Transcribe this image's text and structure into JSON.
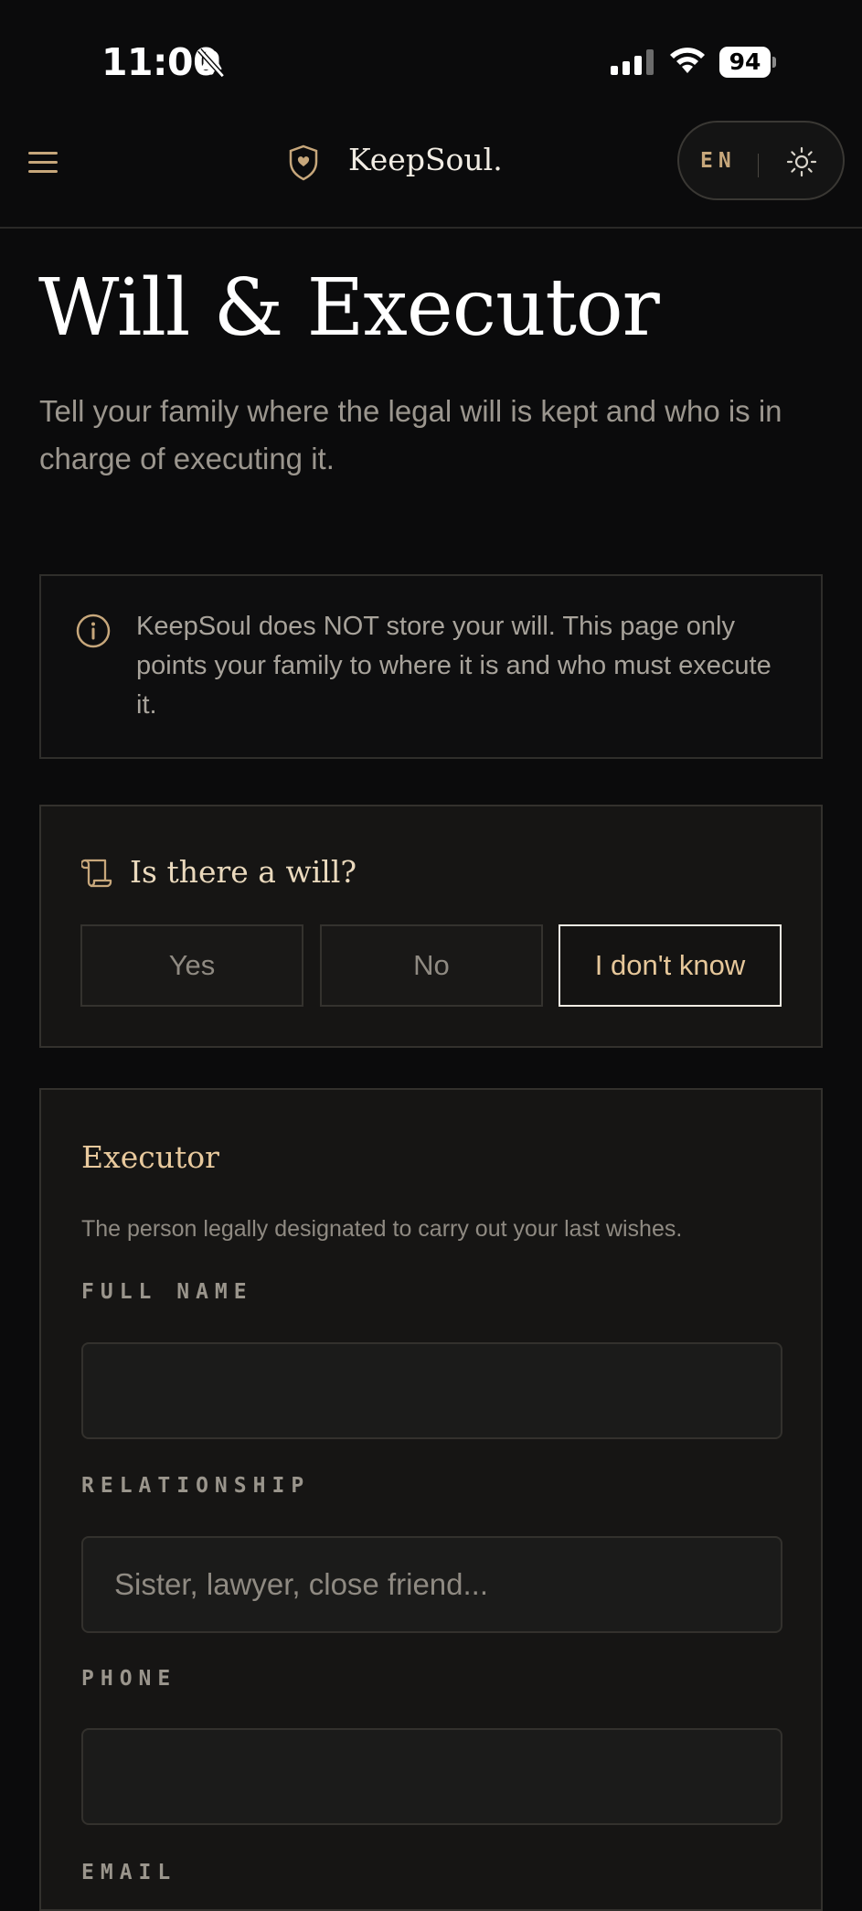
{
  "status_bar": {
    "time": "11:00",
    "battery": "94"
  },
  "header": {
    "brand": "KeepSoul.",
    "language": "EN"
  },
  "page": {
    "title": "Will & Executor",
    "subtitle": "Tell your family where the legal will is kept and who is in charge of executing it."
  },
  "info": {
    "text": "KeepSoul does NOT store your will. This page only points your family to where it is and who must execute it."
  },
  "will": {
    "question": "Is there a will?",
    "options": [
      "Yes",
      "No",
      "I don't know"
    ],
    "selected": "I don't know"
  },
  "executor": {
    "title": "Executor",
    "description": "The person legally designated to carry out your last wishes.",
    "fields": {
      "full_name": {
        "label": "FULL NAME",
        "value": "",
        "placeholder": ""
      },
      "relationship": {
        "label": "RELATIONSHIP",
        "value": "",
        "placeholder": "Sister, lawyer, close friend..."
      },
      "phone": {
        "label": "PHONE",
        "value": "",
        "placeholder": ""
      },
      "email": {
        "label": "EMAIL"
      }
    }
  },
  "colors": {
    "accent": "#c7a77b",
    "background": "#0b0b0c",
    "card": "#161514"
  }
}
